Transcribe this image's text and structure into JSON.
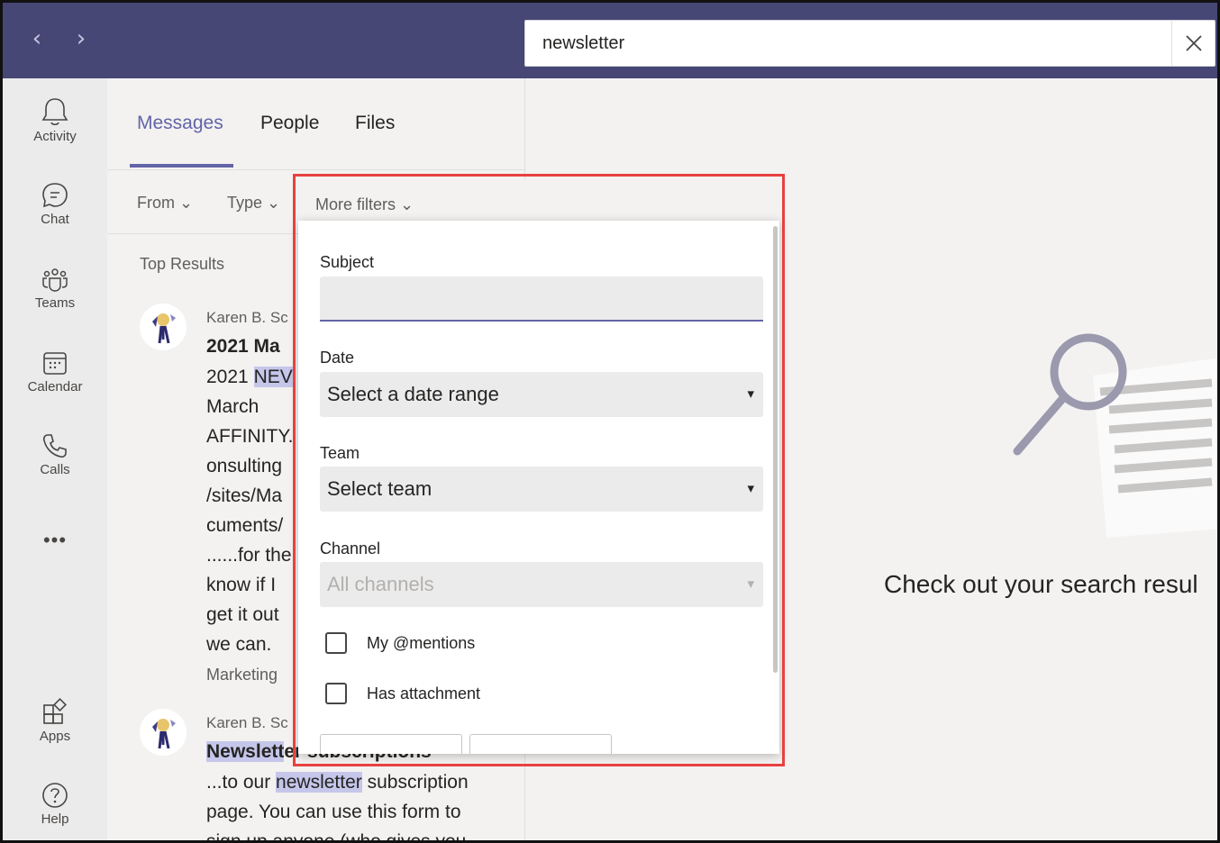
{
  "search": {
    "value": "newsletter"
  },
  "rail": [
    {
      "label": "Activity",
      "icon": "bell-icon"
    },
    {
      "label": "Chat",
      "icon": "chat-icon"
    },
    {
      "label": "Teams",
      "icon": "teams-icon"
    },
    {
      "label": "Calendar",
      "icon": "calendar-icon"
    },
    {
      "label": "Calls",
      "icon": "phone-icon"
    },
    {
      "label": "Apps",
      "icon": "apps-icon"
    },
    {
      "label": "Help",
      "icon": "help-icon"
    }
  ],
  "rail_more": "•••",
  "tabs": [
    "Messages",
    "People",
    "Files"
  ],
  "filters": {
    "from": "From",
    "type": "Type",
    "more": "More filters"
  },
  "section_title": "Top Results",
  "results": [
    {
      "author": "Karen B. Sc",
      "title": "2021 Ma",
      "lines": [
        "2021 ",
        "NEV",
        "March",
        "AFFINITY.",
        "onsulting",
        "/sites/Ma",
        "cuments/",
        "......for the",
        "know if I",
        "get it out",
        "we can."
      ],
      "meta": "Marketing"
    },
    {
      "author": "Karen B. Sc",
      "title": "Newsletter subscriptions",
      "title_hl": "Newslett",
      "title_rest": "er subscriptions",
      "lines": [
        "...to our ",
        "newsletter",
        " subscription",
        "page. You can use this form to",
        "sign up anyone (who gives you"
      ]
    }
  ],
  "more_filters": {
    "subject_label": "Subject",
    "subject_value": "",
    "date_label": "Date",
    "date_value": "Select a date range",
    "team_label": "Team",
    "team_value": "Select team",
    "channel_label": "Channel",
    "channel_value": "All channels",
    "mentions_label": "My @mentions",
    "attachment_label": "Has attachment",
    "caret": "▾"
  },
  "empty_state": "Check out your search resul",
  "colors": {
    "accent": "#6264a7",
    "topbar": "#464775",
    "highlight_border": "#e8413f"
  }
}
